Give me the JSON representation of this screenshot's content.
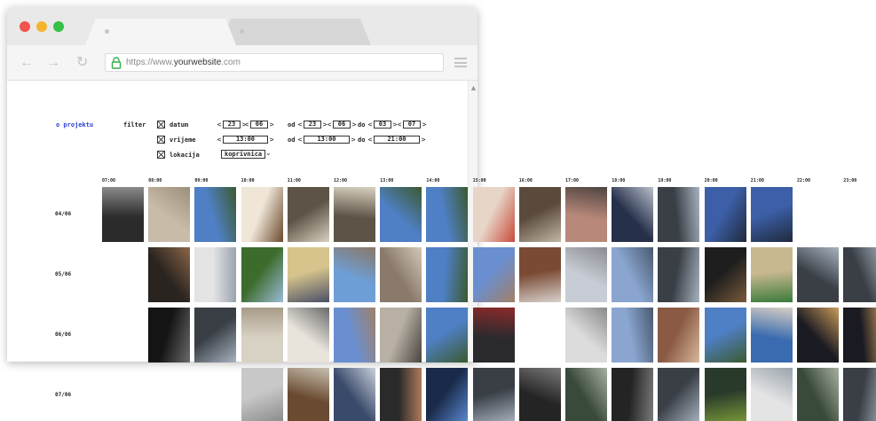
{
  "browser": {
    "url": "https://www.yourwebsite.com",
    "url_prefix": "https://www.",
    "url_domain": "yourwebsite",
    "url_suffix": ".com"
  },
  "page": {
    "about_link": "o projektu",
    "filter_label": "filter",
    "filters": {
      "date": {
        "label": "datum",
        "checked": true,
        "day": "23",
        "month": "06",
        "od_label": "od",
        "from_day": "23",
        "from_month": "06",
        "do_label": "do",
        "to_day": "03",
        "to_month": "07"
      },
      "time": {
        "label": "vrijeme",
        "checked": true,
        "value": "13:00",
        "od_label": "od",
        "from": "13:00",
        "do_label": "do",
        "to": "21:00"
      },
      "location": {
        "label": "lokacija",
        "checked": true,
        "selected": "koprivnica"
      }
    },
    "arrow_left": "<",
    "arrow_right": ">"
  },
  "grid": {
    "hours": [
      "07:00",
      "08:00",
      "09:00",
      "10:00",
      "11:00",
      "12:00",
      "13:00",
      "14:00",
      "15:00",
      "16:00",
      "17:00",
      "18:00",
      "19:00",
      "20:00",
      "21:00",
      "22:00",
      "23:00"
    ],
    "rows": [
      {
        "date": "04/06",
        "photos": [
          {
            "col": 0,
            "scene": "glass"
          },
          {
            "col": 1,
            "scene": "wall"
          },
          {
            "col": 2,
            "scene": "tree-sky"
          },
          {
            "col": 3,
            "scene": "coffee"
          },
          {
            "col": 4,
            "scene": "office"
          },
          {
            "col": 5,
            "scene": "office"
          },
          {
            "col": 6,
            "scene": "tree-sky"
          },
          {
            "col": 7,
            "scene": "tree-sky"
          },
          {
            "col": 8,
            "scene": "food"
          },
          {
            "col": 9,
            "scene": "dark-stripes"
          },
          {
            "col": 10,
            "scene": "fabric"
          },
          {
            "col": 11,
            "scene": "paper-dark"
          },
          {
            "col": 12,
            "scene": "laptop"
          },
          {
            "col": 13,
            "scene": "dusk"
          },
          {
            "col": 14,
            "scene": "dusk"
          }
        ]
      },
      {
        "date": "05/06",
        "photos": [
          {
            "col": 1,
            "scene": "coffee-dark"
          },
          {
            "col": 2,
            "scene": "paper"
          },
          {
            "col": 3,
            "scene": "park"
          },
          {
            "col": 4,
            "scene": "whiteboard"
          },
          {
            "col": 5,
            "scene": "sky-building"
          },
          {
            "col": 6,
            "scene": "interior"
          },
          {
            "col": 7,
            "scene": "tree-sky"
          },
          {
            "col": 8,
            "scene": "building"
          },
          {
            "col": 9,
            "scene": "table-food"
          },
          {
            "col": 10,
            "scene": "birds"
          },
          {
            "col": 11,
            "scene": "street-blue"
          },
          {
            "col": 12,
            "scene": "laptop"
          },
          {
            "col": 13,
            "scene": "pot"
          },
          {
            "col": 14,
            "scene": "bottle"
          },
          {
            "col": 15,
            "scene": "laptop"
          },
          {
            "col": 16,
            "scene": "laptop"
          }
        ]
      },
      {
        "date": "06/06",
        "photos": [
          {
            "col": 1,
            "scene": "dark-window"
          },
          {
            "col": 2,
            "scene": "laptop"
          },
          {
            "col": 3,
            "scene": "switch"
          },
          {
            "col": 4,
            "scene": "notes"
          },
          {
            "col": 5,
            "scene": "building"
          },
          {
            "col": 6,
            "scene": "kitchen"
          },
          {
            "col": 7,
            "scene": "tree-sky"
          },
          {
            "col": 8,
            "scene": "dark-screen"
          },
          {
            "col": 10,
            "scene": "blinds"
          },
          {
            "col": 11,
            "scene": "street-blue"
          },
          {
            "col": 12,
            "scene": "hand"
          },
          {
            "col": 13,
            "scene": "tree-sky"
          },
          {
            "col": 14,
            "scene": "plate"
          },
          {
            "col": 15,
            "scene": "night-screen"
          },
          {
            "col": 16,
            "scene": "night-screen"
          }
        ]
      },
      {
        "date": "07/06",
        "photos": [
          {
            "col": 3,
            "scene": "texture"
          },
          {
            "col": 4,
            "scene": "desk"
          },
          {
            "col": 5,
            "scene": "building-dark"
          },
          {
            "col": 6,
            "scene": "monitor"
          },
          {
            "col": 7,
            "scene": "monitor-blue"
          },
          {
            "col": 8,
            "scene": "laptop"
          },
          {
            "col": 9,
            "scene": "dark-desk"
          },
          {
            "col": 10,
            "scene": "rain-glass"
          },
          {
            "col": 11,
            "scene": "dark-desk"
          },
          {
            "col": 12,
            "scene": "laptop"
          },
          {
            "col": 13,
            "scene": "green-cup"
          },
          {
            "col": 14,
            "scene": "paper"
          },
          {
            "col": 15,
            "scene": "rain-glass"
          },
          {
            "col": 16,
            "scene": "laptop"
          }
        ]
      }
    ],
    "scene_colors": {
      "glass": [
        "#2b2b2b",
        "#8a8a8a"
      ],
      "wall": [
        "#c8bca8",
        "#9c8f7c"
      ],
      "tree-sky": [
        "#4f7fc4",
        "#3b5a2f"
      ],
      "coffee": [
        "#efe6d8",
        "#6b4a2c"
      ],
      "office": [
        "#5d5346",
        "#d8d0c0"
      ],
      "food": [
        "#e7d6c8",
        "#c74a3a"
      ],
      "dark-stripes": [
        "#5a4a3c",
        "#c2b6a4"
      ],
      "fabric": [
        "#b8897a",
        "#4f4440"
      ],
      "paper-dark": [
        "#26304a",
        "#b9c0cc"
      ],
      "laptop": [
        "#3a3f46",
        "#a7b3c0"
      ],
      "dusk": [
        "#3c5fa8",
        "#1f2a3c"
      ],
      "coffee-dark": [
        "#2a2420",
        "#8b6648"
      ],
      "paper": [
        "#e4e4e4",
        "#9aa3ad"
      ],
      "park": [
        "#3d6b2c",
        "#9bbbd8"
      ],
      "whiteboard": [
        "#d6c48c",
        "#4a4f66"
      ],
      "sky-building": [
        "#6e9ed6",
        "#8a7866"
      ],
      "interior": [
        "#8a7a6c",
        "#d4c8b8"
      ],
      "building": [
        "#6a8fd0",
        "#a08068"
      ],
      "table-food": [
        "#7a4a34",
        "#d8d2cc"
      ],
      "birds": [
        "#c8ccd4",
        "#8a8c92"
      ],
      "street-blue": [
        "#8aa6d0",
        "#4a5a70"
      ],
      "pot": [
        "#1e1e1e",
        "#7a5a3a"
      ],
      "bottle": [
        "#c8b890",
        "#3a7a3a"
      ],
      "dark-window": [
        "#141414",
        "#6a6a6a"
      ],
      "switch": [
        "#d8d2c4",
        "#a89c88"
      ],
      "notes": [
        "#e8e4dc",
        "#6a6a6a"
      ],
      "kitchen": [
        "#b8b0a4",
        "#4a4440"
      ],
      "dark-screen": [
        "#2a2a2e",
        "#8a2a2a"
      ],
      "blinds": [
        "#dcdcdc",
        "#8a8a8a"
      ],
      "hand": [
        "#8a5a44",
        "#d8b89c"
      ],
      "plate": [
        "#3a6ab0",
        "#d8d0c4"
      ],
      "night-screen": [
        "#1a1a22",
        "#c89a5a"
      ],
      "texture": [
        "#c8c8c8",
        "#8a8a8a"
      ],
      "desk": [
        "#6a4a30",
        "#c8c0b0"
      ],
      "building-dark": [
        "#3a4a6a",
        "#c8d0dc"
      ],
      "monitor": [
        "#2a2a2a",
        "#b07a5a"
      ],
      "monitor-blue": [
        "#1a2a4a",
        "#5a8ad0"
      ],
      "dark-desk": [
        "#242424",
        "#7a7a7a"
      ],
      "rain-glass": [
        "#3a4a3a",
        "#a8b0a0"
      ],
      "green-cup": [
        "#2a3a2a",
        "#7a9a3a"
      ]
    }
  }
}
